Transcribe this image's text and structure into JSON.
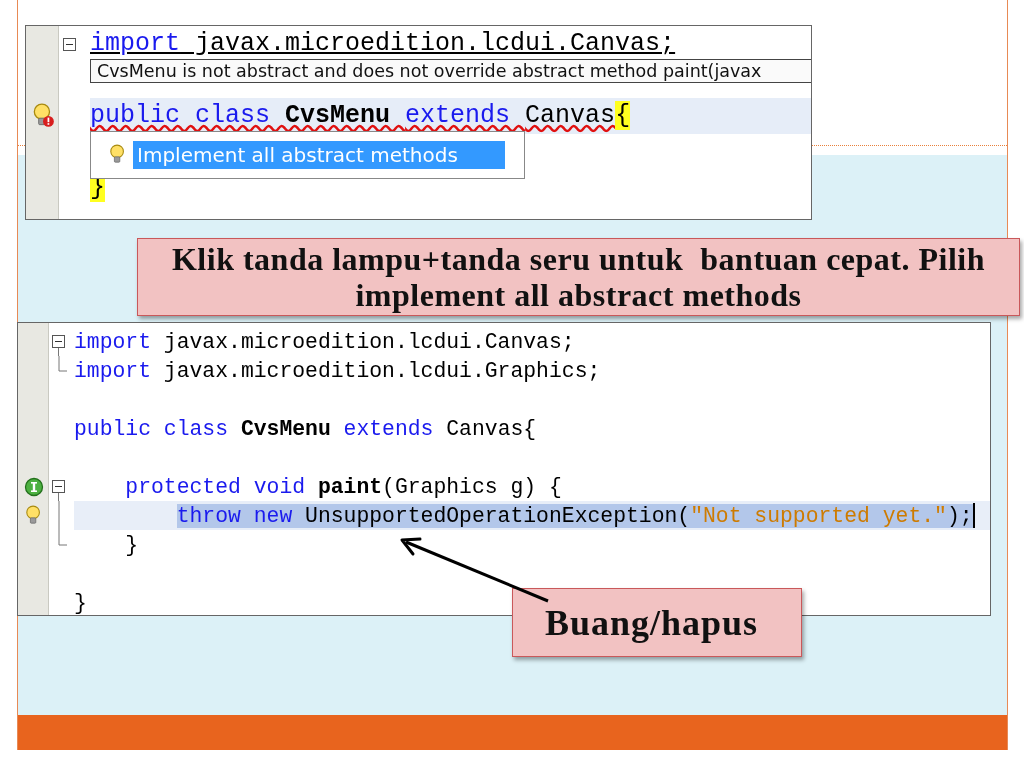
{
  "slide": {
    "top_editor": {
      "lines": [
        {
          "kind": "code",
          "fold": {
            "kind": "start"
          },
          "underlined": true,
          "current": false,
          "error_underline": false,
          "tokens": [
            {
              "kind": "keyword",
              "text": "import"
            },
            {
              "kind": "plain",
              "text": " javax.microedition.lcdui.Canvas;"
            }
          ]
        },
        {
          "kind": "blank"
        },
        {
          "kind": "code",
          "gutter_icon": {
            "kind": "error-bulb"
          },
          "underlined": false,
          "current": true,
          "error_underline": true,
          "tokens": [
            {
              "kind": "keyword",
              "text": "public class "
            },
            {
              "kind": "type",
              "text": "CvsMenu "
            },
            {
              "kind": "keyword",
              "text": "extends "
            },
            {
              "kind": "plain",
              "text": "Canvas"
            },
            {
              "kind": "brace-match",
              "text": "{"
            }
          ]
        },
        {
          "kind": "blank"
        },
        {
          "kind": "code",
          "underlined": false,
          "current": false,
          "tokens": [
            {
              "kind": "brace-match",
              "text": "}"
            }
          ]
        }
      ],
      "tooltip": "CvsMenu is not abstract and does not override abstract method paint(javax",
      "hint_popup": {
        "items": [
          {
            "label": "Implement all abstract methods",
            "selected": true
          }
        ]
      }
    },
    "callout": {
      "lines": [
        "Klik tanda lampu+tanda seru untuk  bantuan cepat. Pilih",
        "implement all abstract methods"
      ]
    },
    "bottom_editor": {
      "lines": [
        {
          "kind": "code",
          "fold": {
            "kind": "start"
          },
          "current": false,
          "caret": false,
          "tokens": [
            {
              "kind": "keyword",
              "text": "import "
            },
            {
              "kind": "plain",
              "text": "javax.microedition.lcdui.Canvas;"
            }
          ]
        },
        {
          "kind": "code",
          "fold": {
            "kind": "end"
          },
          "current": false,
          "caret": false,
          "tokens": [
            {
              "kind": "keyword",
              "text": "import "
            },
            {
              "kind": "plain",
              "text": "javax.microedition.lcdui.Graphics;"
            }
          ]
        },
        {
          "kind": "blank"
        },
        {
          "kind": "code",
          "current": false,
          "caret": false,
          "tokens": [
            {
              "kind": "keyword",
              "text": "public class "
            },
            {
              "kind": "type",
              "text": "CvsMenu "
            },
            {
              "kind": "keyword",
              "text": "extends "
            },
            {
              "kind": "plain",
              "text": "Canvas{"
            }
          ],
          "children": [
            {
              "kind": "blank"
            },
            {
              "kind": "code",
              "gutter_icon": {
                "kind": "implements"
              },
              "fold": {
                "kind": "start"
              },
              "current": false,
              "caret": false,
              "tokens": [
                {
                  "kind": "keyword",
                  "text": "protected void "
                },
                {
                  "kind": "type",
                  "text": "paint"
                },
                {
                  "kind": "plain",
                  "text": "(Graphics g) {"
                }
              ],
              "children": [
                {
                  "kind": "code",
                  "gutter_icon": {
                    "kind": "bulb"
                  },
                  "fold": {
                    "kind": "mid"
                  },
                  "current": true,
                  "caret": true,
                  "tokens": [
                    {
                      "kind": "keyword",
                      "text": "throw new ",
                      "selected": true
                    },
                    {
                      "kind": "plain",
                      "text": "UnsupportedOperationException(",
                      "selected": true
                    },
                    {
                      "kind": "string",
                      "text": "\"Not supported yet.\"",
                      "selected": true
                    },
                    {
                      "kind": "plain",
                      "text": ");",
                      "selected": true
                    }
                  ]
                }
              ]
            },
            {
              "kind": "code",
              "fold": {
                "kind": "end"
              },
              "current": false,
              "caret": false,
              "tokens": [
                {
                  "kind": "plain",
                  "text": "}"
                }
              ]
            },
            {
              "kind": "blank"
            }
          ]
        },
        {
          "kind": "code",
          "current": false,
          "caret": false,
          "tokens": [
            {
              "kind": "plain",
              "text": "}"
            }
          ]
        }
      ]
    },
    "note": {
      "text": "Buang/hapus"
    }
  }
}
